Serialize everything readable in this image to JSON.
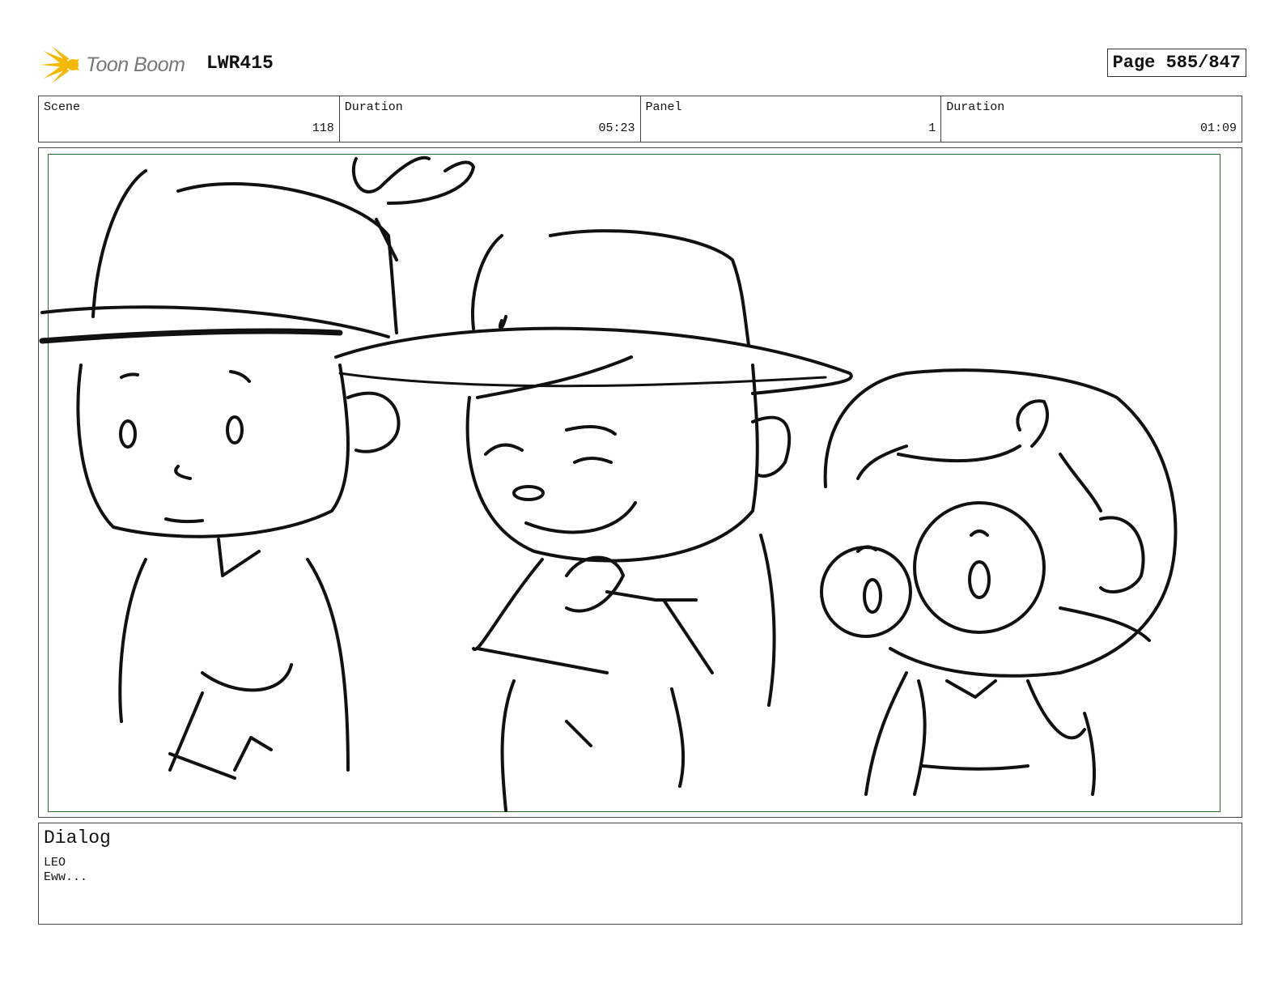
{
  "header": {
    "logo_text": "Toon Boom",
    "project_code": "LWR415",
    "page_label": "Page 585/847"
  },
  "info": {
    "scene_label": "Scene",
    "scene_value": "118",
    "duration_label": "Duration",
    "duration_value": "05:23",
    "panel_label": "Panel",
    "panel_value": "1",
    "panel_duration_label": "Duration",
    "panel_duration_value": "01:09"
  },
  "dialog": {
    "title": "Dialog",
    "speaker": "LEO",
    "line": "Eww..."
  },
  "colors": {
    "frame_green": "#2a6a2a",
    "logo_yellow": "#f5b800"
  },
  "icons": {
    "logo": "starburst-logo-icon"
  }
}
